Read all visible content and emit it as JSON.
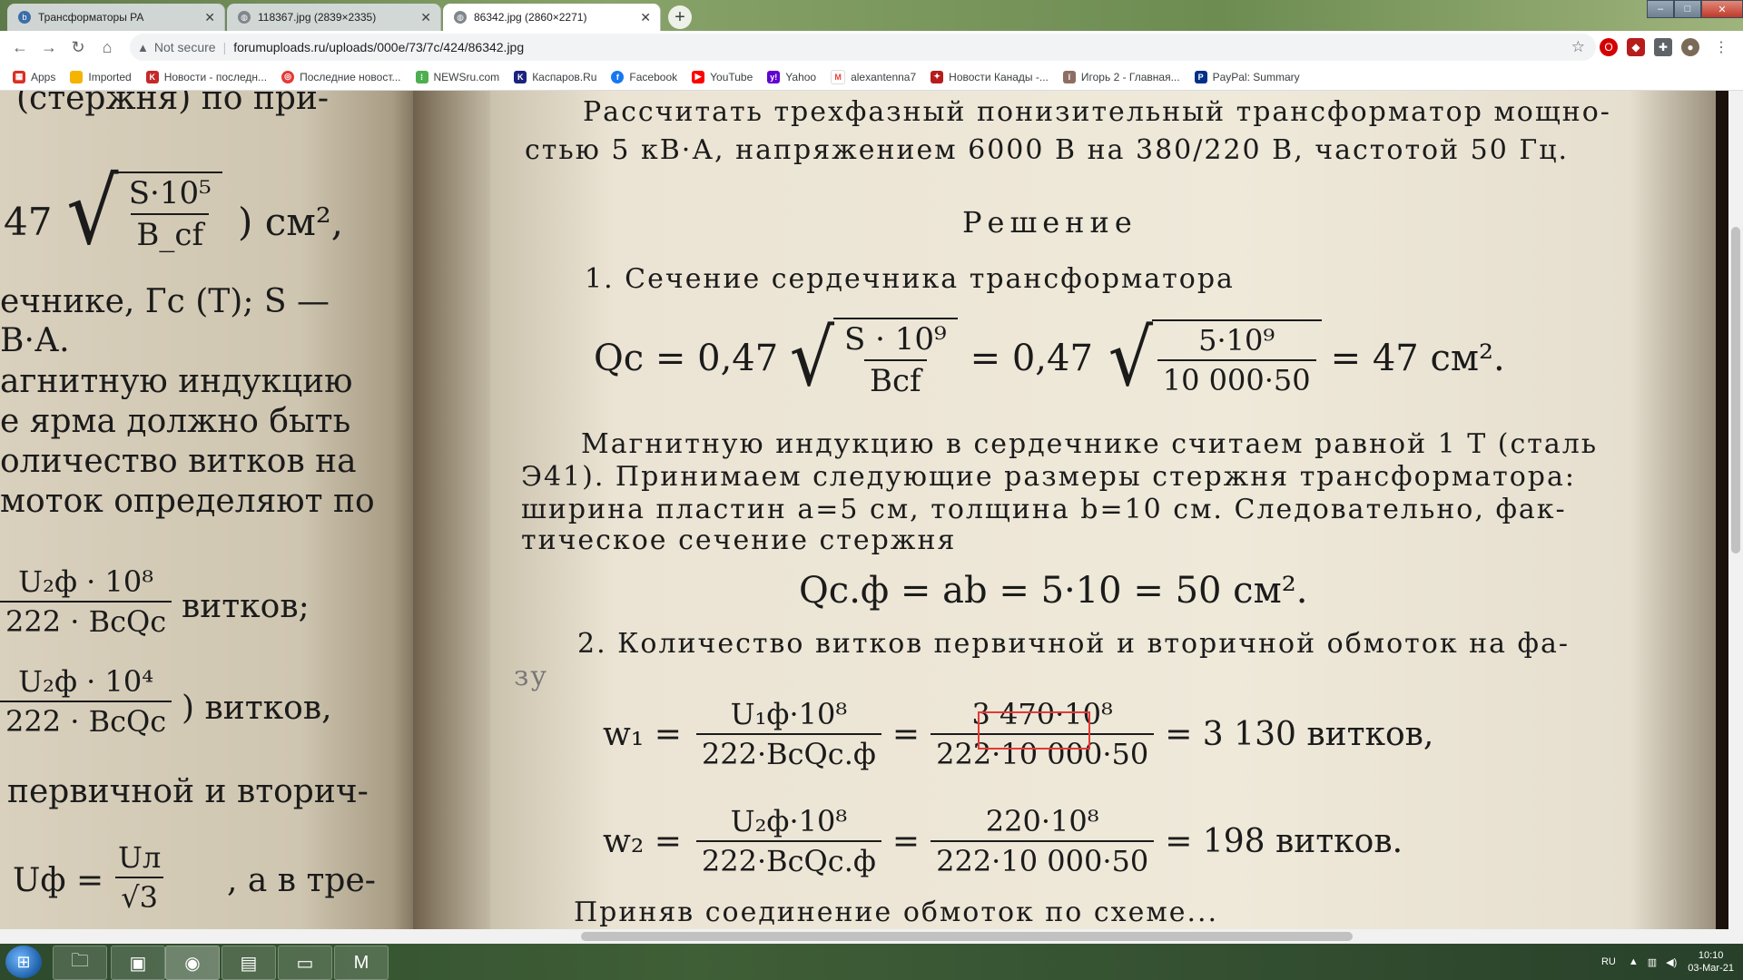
{
  "browser": {
    "tabs": [
      {
        "title": "Трансформаторы РА",
        "favicon_color": "#3b6ea8"
      },
      {
        "title": "118367.jpg (2839×2335)",
        "favicon_color": "#5f6368"
      },
      {
        "title": "86342.jpg (2860×2271)",
        "favicon_color": "#5f6368"
      }
    ],
    "new_tab_label": "+",
    "address": {
      "security": "Not secure",
      "url": "forumuploads.ru/uploads/000e/73/7c/424/86342.jpg"
    },
    "bookmarks": [
      {
        "label": "Apps",
        "color": "#d93025"
      },
      {
        "label": "Imported",
        "color": "#f4b400"
      },
      {
        "label": "Новости - последн...",
        "color": "#c62828"
      },
      {
        "label": "Последние новост...",
        "color": "#e53935"
      },
      {
        "label": "NEWSru.com",
        "color": "#4caf50"
      },
      {
        "label": "Каспаров.Ru",
        "color": "#1a237e"
      },
      {
        "label": "Facebook",
        "color": "#1877f2"
      },
      {
        "label": "YouTube",
        "color": "#ff0000"
      },
      {
        "label": "Yahoo",
        "color": "#6001d2"
      },
      {
        "label": "alexantenna7",
        "color": "#ea4335"
      },
      {
        "label": "Новости Канады -...",
        "color": "#b71c1c"
      },
      {
        "label": "Игорь 2 - Главная...",
        "color": "#8d6e63"
      },
      {
        "label": "PayPal: Summary",
        "color": "#003087"
      }
    ]
  },
  "book_left": {
    "lines": [
      "(стержня) по при-",
      "47",
      "S·10⁵",
      "B_cf",
      ") см²,",
      "ечнике, Гс (Т); S —",
      "В·А.",
      "агнитную  индукцию",
      "е  ярма должно быть",
      "оличество витков на",
      "моток определяют по",
      "U₂ф · 10⁸",
      "222 · BcQc",
      "витков;",
      "U₂ф · 10⁴",
      "222 · BcQc",
      ") витков,",
      "первичной и вторич-",
      "Uф =",
      "Uл",
      "√3",
      ", а  в  тре-"
    ]
  },
  "book_right": {
    "p1": "Рассчитать трехфазный понизительный трансформатор мощно-",
    "p2": "стью 5 кВ·А, напряжением 6000 В на 380/220 В, частотой 50 Гц.",
    "heading": "Решение",
    "s1": "1. Сечение сердечника трансформатора",
    "f1_left": "Qс = 0,47",
    "f1_num": "S · 10⁹",
    "f1_den": "Bcf",
    "f1_mid": "= 0,47",
    "f1_num2": "5·10⁹",
    "f1_den2": "10 000·50",
    "f1_result": "= 47  см².",
    "p3": "Магнитную индукцию в сердечнике считаем равной 1 Т (сталь",
    "p4": "Э41). Принимаем следующие размеры стержня  трансформатора:",
    "p5": "ширина пластин a=5 см, толщина b=10 см. Следовательно, фак-",
    "p6": "тическое сечение стержня",
    "f2": "Qс.ф = ab = 5·10 = 50  см².",
    "s2": "2. Количество витков первичной и вторичной обмоток на фа-",
    "s2b": "зу",
    "w1_lhs": "w₁ =",
    "w1_num": "U₁ф·10⁸",
    "w1_den": "222·BcQс.ф",
    "w1_num2": "3 470·10⁸",
    "w1_den2": "222·10 000·50",
    "w1_res": "= 3 130  витков,",
    "w2_lhs": "w₂ =",
    "w2_num": "U₂ф·10⁸",
    "w2_den": "222·BcQс.ф",
    "w2_num2": "220·10⁸",
    "w2_den2": "222·10 000·50",
    "w2_res": "= 198  витков.",
    "p7": "Приняв  соединение  обмоток  по  схеме..."
  },
  "taskbar": {
    "lang": "RU",
    "time": "10:10",
    "date": "03-Mar-21"
  }
}
